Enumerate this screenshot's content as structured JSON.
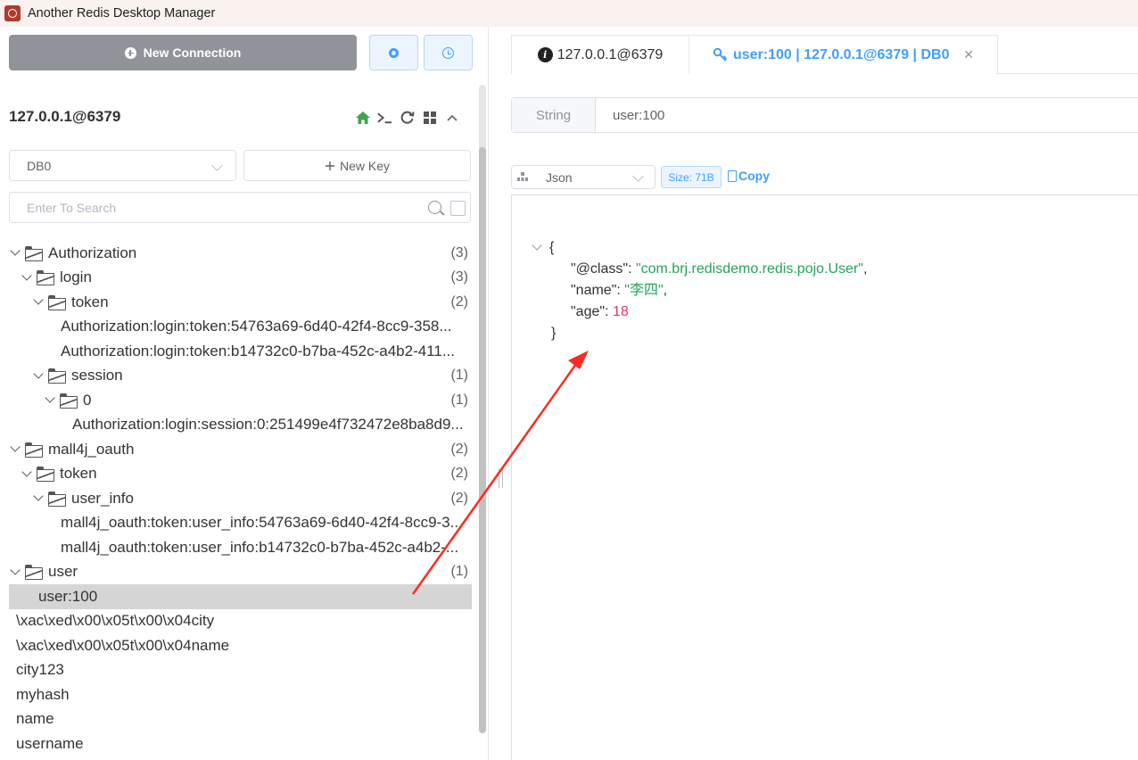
{
  "window": {
    "title": "Another Redis Desktop Manager"
  },
  "toolbar": {
    "new_connection_label": "New Connection"
  },
  "connection": {
    "name": "127.0.0.1@6379"
  },
  "db_select": {
    "value": "DB0"
  },
  "new_key_label": "New Key",
  "search": {
    "placeholder": "Enter To Search"
  },
  "tree": [
    {
      "label": "Authorization",
      "count": "(3)"
    },
    {
      "label": "login",
      "count": "(3)"
    },
    {
      "label": "token",
      "count": "(2)"
    },
    {
      "label": "Authorization:login:token:54763a69-6d40-42f4-8cc9-358..."
    },
    {
      "label": "Authorization:login:token:b14732c0-b7ba-452c-a4b2-411..."
    },
    {
      "label": "session",
      "count": "(1)"
    },
    {
      "label": "0",
      "count": "(1)"
    },
    {
      "label": "Authorization:login:session:0:251499e4f732472e8ba8d9..."
    },
    {
      "label": "mall4j_oauth",
      "count": "(2)"
    },
    {
      "label": "token",
      "count": "(2)"
    },
    {
      "label": "user_info",
      "count": "(2)"
    },
    {
      "label": "mall4j_oauth:token:user_info:54763a69-6d40-42f4-8cc9-3..."
    },
    {
      "label": "mall4j_oauth:token:user_info:b14732c0-b7ba-452c-a4b2-..."
    },
    {
      "label": "user",
      "count": "(1)"
    },
    {
      "label": "user:100"
    },
    {
      "label": "\\xac\\xed\\x00\\x05t\\x00\\x04city"
    },
    {
      "label": "\\xac\\xed\\x00\\x05t\\x00\\x04name"
    },
    {
      "label": "city123"
    },
    {
      "label": "myhash"
    },
    {
      "label": "name"
    },
    {
      "label": "username"
    }
  ],
  "tabs": [
    {
      "label": "127.0.0.1@6379"
    },
    {
      "label": "user:100 | 127.0.0.1@6379 | DB0"
    }
  ],
  "key_detail": {
    "type": "String",
    "key": "user:100",
    "format": "Json",
    "size": "Size: 71B",
    "copy_label": "Copy"
  },
  "json_view": {
    "open": "{",
    "close": "}",
    "fields": [
      {
        "key": "\"@class\"",
        "value": "\"com.brj.redisdemo.redis.pojo.User\"",
        "kind": "str"
      },
      {
        "key": "\"name\"",
        "value": "\"李四\"",
        "kind": "str"
      },
      {
        "key": "\"age\"",
        "value": "18",
        "kind": "num"
      }
    ]
  },
  "colors": {
    "accent": "#409eff",
    "string": "#22a35a",
    "number": "#e5336b",
    "annotation": "#ff2a1f"
  }
}
